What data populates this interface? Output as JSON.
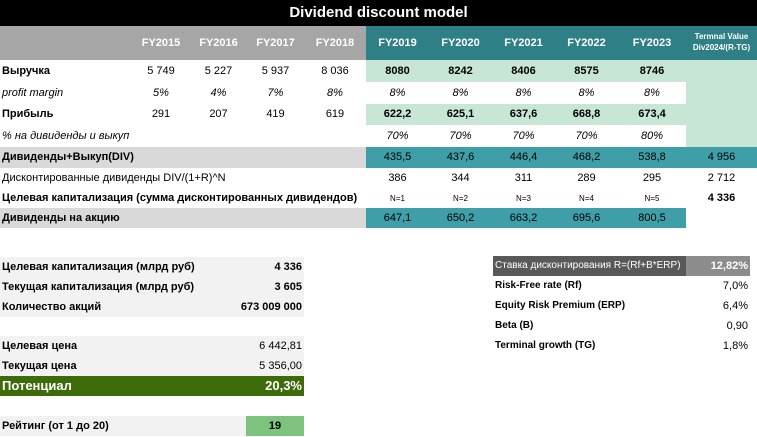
{
  "title": "Dividend discount model",
  "years": [
    "FY2015",
    "FY2016",
    "FY2017",
    "FY2018",
    "FY2019",
    "FY2020",
    "FY2021",
    "FY2022",
    "FY2023"
  ],
  "terminal_header": [
    "Termnal Value",
    "Div2024/(R-TG)"
  ],
  "rows": {
    "revenue": {
      "label": "Выручка",
      "values": [
        "5 749",
        "5 227",
        "5 937",
        "8 036",
        "8080",
        "8242",
        "8406",
        "8575",
        "8746"
      ]
    },
    "margin": {
      "label": "profit margin",
      "values": [
        "5%",
        "4%",
        "7%",
        "8%",
        "8%",
        "8%",
        "8%",
        "8%",
        "8%"
      ]
    },
    "profit": {
      "label": "Прибыль",
      "values": [
        "291",
        "207",
        "419",
        "619",
        "622,2",
        "625,1",
        "637,6",
        "668,8",
        "673,4"
      ]
    },
    "payout": {
      "label": "% на дивиденды и выкуп",
      "values": [
        "70%",
        "70%",
        "70%",
        "70%",
        "80%"
      ]
    },
    "div": {
      "label": "Дивиденды+Выкуп(DIV)",
      "values": [
        "435,5",
        "437,6",
        "446,4",
        "468,2",
        "538,8"
      ],
      "terminal": "4 956"
    },
    "disc": {
      "label": "Дисконтированные дивиденды DIV/(1+R)^N",
      "values": [
        "386",
        "344",
        "311",
        "289",
        "295"
      ],
      "terminal": "2 712"
    },
    "target": {
      "label": "Целевая капитализация (сумма дисконтированных дивидендов)",
      "values": [
        "N=1",
        "N=2",
        "N=3",
        "N=4",
        "N=5"
      ],
      "terminal": "4 336"
    },
    "dps": {
      "label": "Дивиденды на акцию",
      "values": [
        "647,1",
        "650,2",
        "663,2",
        "695,6",
        "800,5"
      ]
    }
  },
  "summary": {
    "target_cap": {
      "label": "Целевая капитализация (млрд руб)",
      "value": "4 336"
    },
    "current_cap": {
      "label": "Текущая капитализация (млрд руб)",
      "value": "3 605"
    },
    "shares": {
      "label": "Количество акций",
      "value": "673 009 000"
    },
    "target_price": {
      "label": "Целевая цена",
      "value": "6 442,81"
    },
    "current_price": {
      "label": "Текущая цена",
      "value": "5 356,00"
    },
    "potential": {
      "label": "Потенциал",
      "value": "20,3%"
    },
    "rating": {
      "label": "Рейтинг (от 1 до 20)",
      "value": "19"
    }
  },
  "rates": {
    "discount": {
      "label": "Ставка дисконтирования R=(Rf+B*ERP)",
      "value": "12,82%"
    },
    "rf": {
      "label": "Risk-Free rate (Rf)",
      "value": "7,0%"
    },
    "erp": {
      "label": "Equity Risk Premium (ERP)",
      "value": "6,4%"
    },
    "beta": {
      "label": "Beta (B)",
      "value": "0,90"
    },
    "tg": {
      "label": "Terminal growth (TG)",
      "value": "1,8%"
    }
  },
  "colors": {
    "header_gray": "#a6a6a6",
    "header_teal": "#2e7f86",
    "mint": "#c8e6d6",
    "teal": "#3e9fa8",
    "potential": "#3d6b0a",
    "rating": "#7dc37e"
  }
}
